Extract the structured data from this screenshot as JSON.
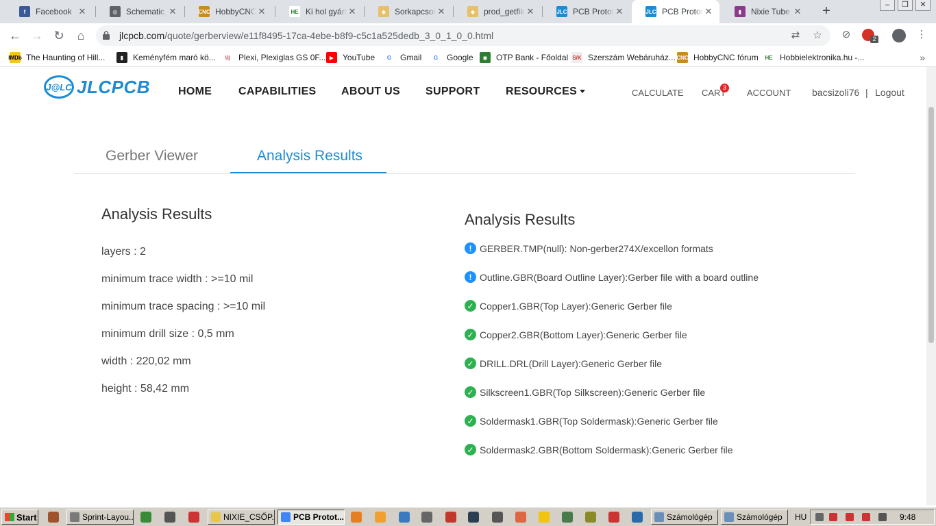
{
  "browser": {
    "tabs": [
      {
        "title": "Facebook",
        "icon": "facebook-icon",
        "color": "#3b5998",
        "glyph": "f"
      },
      {
        "title": "Schematic_Na",
        "icon": "globe-icon",
        "color": "#5f6368",
        "glyph": "◎"
      },
      {
        "title": "HobbyCNC fó",
        "icon": "hobbycnc-icon",
        "color": "#c98b1a",
        "glyph": "CNC"
      },
      {
        "title": "Ki hol gyártat",
        "icon": "hobbielektronika-icon",
        "color": "#ffffff",
        "glyph": "HE"
      },
      {
        "title": "Sorkapcsok -",
        "icon": "tag-icon",
        "color": "#e8c06a",
        "glyph": "◆"
      },
      {
        "title": "prod_getfile.p",
        "icon": "tag-icon",
        "color": "#e8c06a",
        "glyph": "◆"
      },
      {
        "title": "PCB Prototyp",
        "icon": "jlcpcb-icon",
        "color": "#1b8bd3",
        "glyph": "JLC"
      },
      {
        "title": "PCB Prototyp",
        "icon": "jlcpcb-icon",
        "color": "#1b8bd3",
        "glyph": "JLC"
      },
      {
        "title": "Nixie Tube Cl",
        "icon": "nixie-icon",
        "color": "#8a3a8a",
        "glyph": "▮"
      }
    ],
    "url_host": "jlcpcb.com",
    "url_path": "/quote/gerberview/e11f8495-17ca-4ebe-b8f9-c5c1a525dedb_3_0_1_0_0.html",
    "extension_badge": "2"
  },
  "bookmarks": [
    {
      "label": "The Haunting of Hill...",
      "icon": "imdb-icon",
      "color": "#f5c518",
      "glyph": "IMDb",
      "fg": "#000"
    },
    {
      "label": "Keményfém maró kö...",
      "icon": "bag-icon",
      "color": "#222222",
      "glyph": "▮",
      "fg": "#fff"
    },
    {
      "label": "Plexi, Plexiglas GS 0F...",
      "icon": "plexi-icon",
      "color": "#ffffff",
      "glyph": "\\\\|",
      "fg": "#c33"
    },
    {
      "label": "YouTube",
      "icon": "youtube-icon",
      "color": "#ff0000",
      "glyph": "▶",
      "fg": "#fff"
    },
    {
      "label": "Gmail",
      "icon": "google-icon",
      "color": "#ffffff",
      "glyph": "G",
      "fg": "#4285f4"
    },
    {
      "label": "Google",
      "icon": "google-icon",
      "color": "#ffffff",
      "glyph": "G",
      "fg": "#4285f4"
    },
    {
      "label": "OTP Bank - Főoldal",
      "icon": "otp-icon",
      "color": "#2e7d32",
      "glyph": "◉",
      "fg": "#fff"
    },
    {
      "label": "Szerszám Webáruház...",
      "icon": "szerszam-icon",
      "color": "#eeeeee",
      "glyph": "S/K",
      "fg": "#c33"
    },
    {
      "label": "HobbyCNC fórum",
      "icon": "hobbycnc-icon",
      "color": "#c98b1a",
      "glyph": "CNC",
      "fg": "#fff"
    },
    {
      "label": "Hobbielektronika.hu -...",
      "icon": "hobbielektronika-icon",
      "color": "#ffffff",
      "glyph": "HE",
      "fg": "#2a7a2a"
    }
  ],
  "site": {
    "logo_badge": "J@LC",
    "logo_text": "JLCPCB",
    "nav": {
      "home": "HOME",
      "capabilities": "CAPABILITIES",
      "about": "ABOUT US",
      "support": "SUPPORT",
      "resources": "RESOURCES"
    },
    "subnav": {
      "calculate": "CALCULATE",
      "cart": "CART",
      "cart_count": "3",
      "account": "ACCOUNT",
      "user": "bacsizoli76",
      "separator": "|",
      "logout": "Logout"
    },
    "accent": "#1b8bd3"
  },
  "tabs": {
    "gerber_viewer": "Gerber Viewer",
    "analysis_results": "Analysis Results"
  },
  "summary": {
    "heading": "Analysis Results",
    "stats": [
      "layers : 2",
      "minimum trace width : >=10 mil",
      "minimum trace spacing : >=10 mil",
      "minimum drill size : 0,5 mm",
      "width : 220,02 mm",
      "height : 58,42 mm"
    ]
  },
  "results": {
    "heading": "Analysis Results",
    "items": [
      {
        "status": "info",
        "text": "GERBER.TMP(null): Non-gerber274X/excellon formats"
      },
      {
        "status": "info",
        "text": "Outline.GBR(Board Outline Layer):Gerber file with a board outline"
      },
      {
        "status": "ok",
        "text": "Copper1.GBR(Top Layer):Generic Gerber file"
      },
      {
        "status": "ok",
        "text": "Copper2.GBR(Bottom Layer):Generic Gerber file"
      },
      {
        "status": "ok",
        "text": "DRILL.DRL(Drill Layer):Generic Gerber file"
      },
      {
        "status": "ok",
        "text": "Silkscreen1.GBR(Top Silkscreen):Generic Gerber file"
      },
      {
        "status": "ok",
        "text": "Soldermask1.GBR(Top Soldermask):Generic Gerber file"
      },
      {
        "status": "ok",
        "text": "Soldermask2.GBR(Bottom Soldermask):Generic Gerber file"
      }
    ]
  },
  "taskbar": {
    "start": "Start",
    "buttons": [
      {
        "label": "Sprint-Layou...",
        "color": "#7a7a7a"
      },
      {
        "label": "NIXIE_CSŐP...",
        "color": "#e8c64a"
      },
      {
        "label": "PCB Protot...",
        "color": "#4285f4"
      },
      {
        "label": "Számológép",
        "color": "#6a8fb8"
      },
      {
        "label": "Számológép",
        "color": "#6a8fb8"
      }
    ],
    "language": "HU",
    "clock": "9:48"
  }
}
